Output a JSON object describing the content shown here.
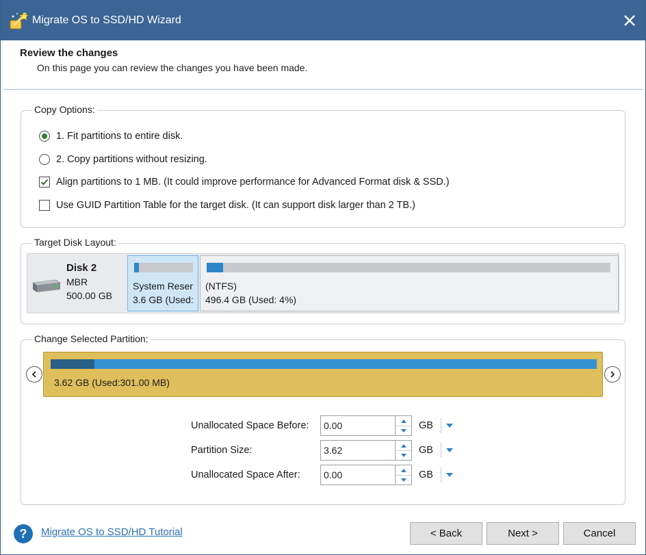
{
  "window": {
    "title": "Migrate OS to SSD/HD Wizard",
    "icon": "wizard-wand-icon",
    "title_bar_color": "#3c6494"
  },
  "header": {
    "title": "Review the changes",
    "subtitle": "On this page you can review the changes you have been made."
  },
  "copy_options": {
    "legend": "Copy Options:",
    "options": [
      {
        "label": "1. Fit partitions to entire disk.",
        "type": "radio",
        "checked": true
      },
      {
        "label": "2. Copy partitions without resizing.",
        "type": "radio",
        "checked": false
      },
      {
        "label": "Align partitions to 1 MB.  (It could improve performance for Advanced Format disk & SSD.)",
        "type": "checkbox",
        "checked": true
      },
      {
        "label": "Use GUID Partition Table for the target disk. (It can support disk larger than 2 TB.)",
        "type": "checkbox",
        "checked": false
      }
    ]
  },
  "target_disk_layout": {
    "legend": "Target Disk Layout:",
    "disk": {
      "name": "Disk 2",
      "type": "MBR",
      "size": "500.00 GB",
      "icon": "hard-disk-icon"
    },
    "partitions": [
      {
        "label": "System Reser",
        "detail": "3.6 GB (Used:",
        "selected": true,
        "used_fraction": 0.08
      },
      {
        "label": "(NTFS)",
        "detail": "496.4 GB (Used: 4%)",
        "selected": false,
        "used_fraction": 0.04
      }
    ]
  },
  "change_partition": {
    "legend": "Change Selected Partition:",
    "partition_label": "3.62 GB (Used:301.00 MB)",
    "used_fraction": 0.08,
    "partition_color": "#dfbe5c",
    "bar_color": "#3392d4",
    "used_color": "#2a5f86",
    "fields": [
      {
        "label": "Unallocated Space Before:",
        "value": "0.00",
        "unit": "GB"
      },
      {
        "label": "Partition Size:",
        "value": "3.62",
        "unit": "GB"
      },
      {
        "label": "Unallocated Space After:",
        "value": "0.00",
        "unit": "GB"
      }
    ]
  },
  "footer": {
    "help_link": "Migrate OS to SSD/HD Tutorial",
    "back_label": "< Back",
    "next_label": "Next >",
    "cancel_label": "Cancel"
  }
}
